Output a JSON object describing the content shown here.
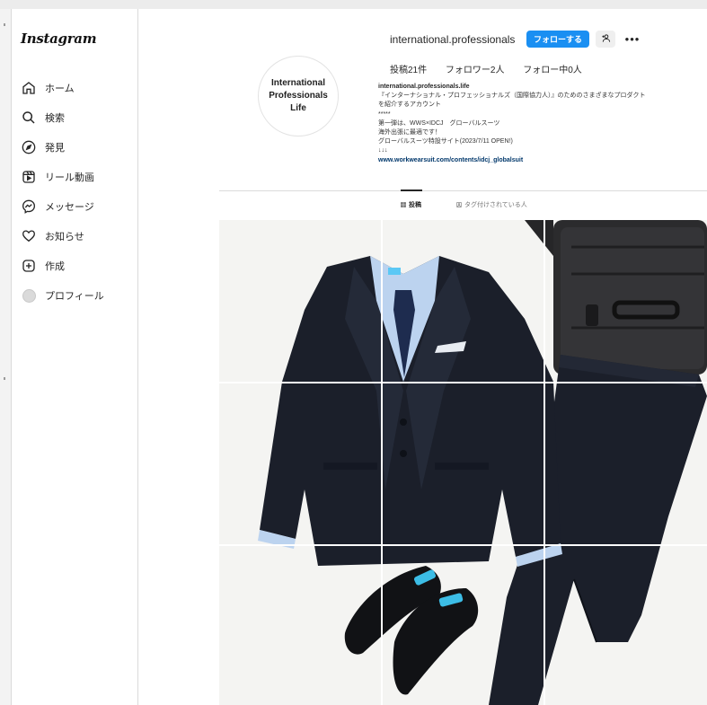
{
  "app": {
    "logo": "Instagram"
  },
  "sidebar": {
    "items": [
      {
        "label": "ホーム",
        "icon": "home-icon"
      },
      {
        "label": "検索",
        "icon": "search-icon"
      },
      {
        "label": "発見",
        "icon": "compass-icon"
      },
      {
        "label": "リール動画",
        "icon": "reels-icon"
      },
      {
        "label": "メッセージ",
        "icon": "messenger-icon"
      },
      {
        "label": "お知らせ",
        "icon": "heart-icon"
      },
      {
        "label": "作成",
        "icon": "plus-square-icon"
      },
      {
        "label": "プロフィール",
        "icon": "avatar"
      }
    ]
  },
  "profile": {
    "picture_text": [
      "International",
      "Professionals",
      "Life"
    ],
    "username": "international.professionals",
    "follow_label": "フォローする",
    "stats": {
      "posts": "投稿21件",
      "followers": "フォロワー2人",
      "following": "フォロー中0人"
    },
    "bio": {
      "name": "international.professionals.life",
      "lines": [
        "『インターナショナル・プロフェッショナルズ（国際協力人）』のためのさまざまなプロダクト",
        "を紹介するアカウント",
        "*****",
        "第一弾は、WWS×IDCJ　グローバルスーツ",
        "海外出張に最適です！",
        "グローバルスーツ特設サイト(2023/7/11 OPEN!)",
        "↓↓↓"
      ],
      "link": "www.workwearsuit.com/contents/idcj_globalsuit"
    }
  },
  "tabs": [
    {
      "label": "投稿",
      "icon": "grid-icon",
      "active": true
    },
    {
      "label": "タグ付けされている人",
      "icon": "tag-icon",
      "active": false
    }
  ],
  "colors": {
    "follow_button": "#1a8ff2",
    "suit": "#1b1f2a",
    "shirt": "#bcd3ef",
    "tie": "#1e2c4f",
    "luggage": "#2b2b2d"
  }
}
